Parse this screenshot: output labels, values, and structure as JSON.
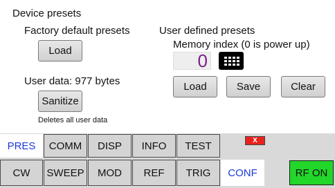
{
  "section_title": "Device presets",
  "factory": {
    "heading": "Factory default presets",
    "load_label": "Load"
  },
  "user_data": {
    "label": "User data: 977 bytes",
    "sanitize_label": "Sanitize",
    "note": "Deletes all user data"
  },
  "user_presets": {
    "heading": "User defined presets",
    "memory_label": "Memory index (0 is power up)",
    "memory_value": "0",
    "load_label": "Load",
    "save_label": "Save",
    "clear_label": "Clear"
  },
  "tabs_top": [
    "PRES",
    "COMM",
    "DISP",
    "INFO",
    "TEST"
  ],
  "tabs_bottom": [
    "CW",
    "SWEEP",
    "MOD",
    "REF",
    "TRIG",
    "CONF"
  ],
  "active_tab": "PRES",
  "close_label": "X",
  "rf_label": "RF ON",
  "colors": {
    "active_tab_text": "#1a3ad6",
    "memory_value": "#7b1f8c",
    "rf_on": "#22d62a",
    "close": "#e8231c"
  }
}
